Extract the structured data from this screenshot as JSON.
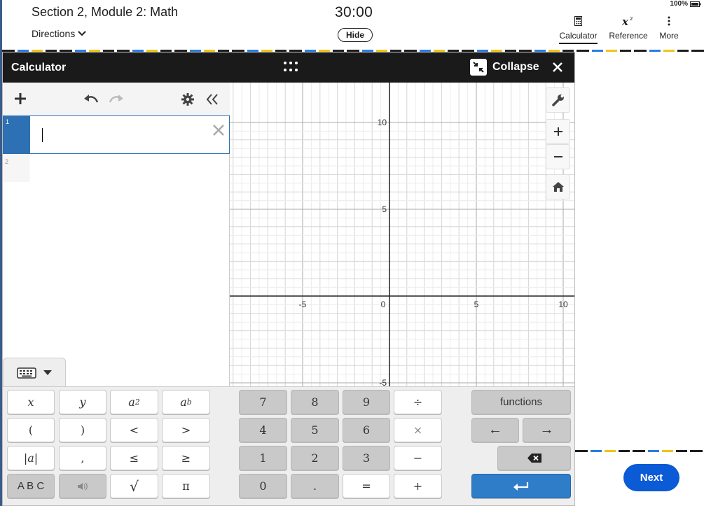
{
  "header": {
    "section_title": "Section 2, Module 2: Math",
    "directions_label": "Directions",
    "timer": "30:00",
    "hide_label": "Hide",
    "battery": "100%",
    "tools": {
      "calculator": "Calculator",
      "reference": "Reference",
      "more": "More"
    }
  },
  "calculator": {
    "title": "Calculator",
    "collapse_label": "Collapse",
    "expression_rows": [
      "1",
      "2"
    ],
    "graph": {
      "x_ticks": [
        "-5",
        "0",
        "5",
        "10"
      ],
      "y_ticks": [
        "10",
        "5",
        "-5"
      ]
    },
    "keyboard": {
      "functions_label": "functions",
      "abc_label": "A B C",
      "keys": {
        "x": "x",
        "y": "y",
        "a_sq": "a²",
        "a_b": "a",
        "lparen": "(",
        "rparen": ")",
        "lt": "<",
        "gt": ">",
        "abs": "|a|",
        "comma": ",",
        "le": "≤",
        "ge": "≥",
        "sqrt": "√",
        "pi": "π",
        "n7": "7",
        "n8": "8",
        "n9": "9",
        "div": "÷",
        "n4": "4",
        "n5": "5",
        "n6": "6",
        "mul": "×",
        "n1": "1",
        "n2": "2",
        "n3": "3",
        "minus": "−",
        "n0": "0",
        "dot": ".",
        "eq": "=",
        "plus": "+",
        "left": "←",
        "right": "→"
      }
    }
  },
  "footer": {
    "next_label": "Next"
  },
  "colors": {
    "accent": "#2d70b3",
    "next": "#0b5ad6",
    "titlebar": "#1a1a1a"
  }
}
